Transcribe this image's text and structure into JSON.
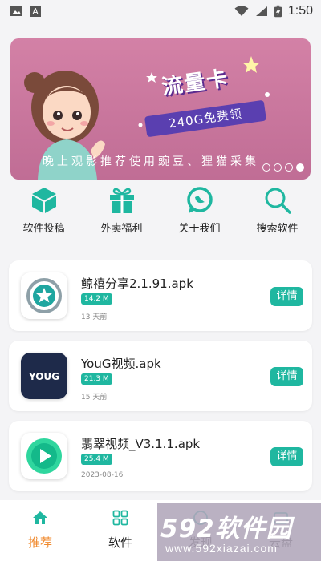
{
  "status_bar": {
    "time": "1:50",
    "left_icons": [
      "image-icon",
      "font-a-icon"
    ],
    "right_icons": [
      "wifi-icon",
      "mobile-signal-icon",
      "battery-charging-icon"
    ]
  },
  "banner": {
    "title": "流量卡",
    "subtitle": "240G免费领",
    "caption": "晚上观影推荐使用豌豆、狸猫采集",
    "slide_count": 4,
    "active_slide": 4,
    "colors": {
      "background": "#cc7ca0",
      "badge": "#5a3fb0"
    }
  },
  "quick_actions": [
    {
      "label": "软件投稿",
      "icon": "cube-icon"
    },
    {
      "label": "外卖福利",
      "icon": "gift-icon"
    },
    {
      "label": "关于我们",
      "icon": "chat-bubble-icon"
    },
    {
      "label": "搜索软件",
      "icon": "search-icon"
    }
  ],
  "apps": [
    {
      "name": "鲸禧分享2.1.91.apk",
      "size": "14.2 M",
      "date": "13 天前",
      "button": "详情",
      "icon": "star-circle-icon"
    },
    {
      "name": "YouG视频.apk",
      "size": "21.3 M",
      "date": "15 天前",
      "button": "详情",
      "icon": "youg-logo-icon",
      "icon_text": "YOUG"
    },
    {
      "name": "翡翠视频_V3.1.1.apk",
      "size": "25.4 M",
      "date": "2023-08-16",
      "button": "详情",
      "icon": "play-button-icon"
    }
  ],
  "tabs": [
    {
      "label": "推荐",
      "icon": "home-icon",
      "active": true
    },
    {
      "label": "软件",
      "icon": "grid-icon",
      "active": false
    },
    {
      "label": "发现",
      "icon": "compass-icon",
      "active": false
    },
    {
      "label": "云盘",
      "icon": "cloud-drive-icon",
      "active": false
    }
  ],
  "watermark": {
    "brand": "592软件园",
    "url": "www.592xiazai.com"
  },
  "colors": {
    "accent": "#1fb7a0",
    "tab_active": "#f08a2e",
    "background": "#f4f4f6"
  }
}
